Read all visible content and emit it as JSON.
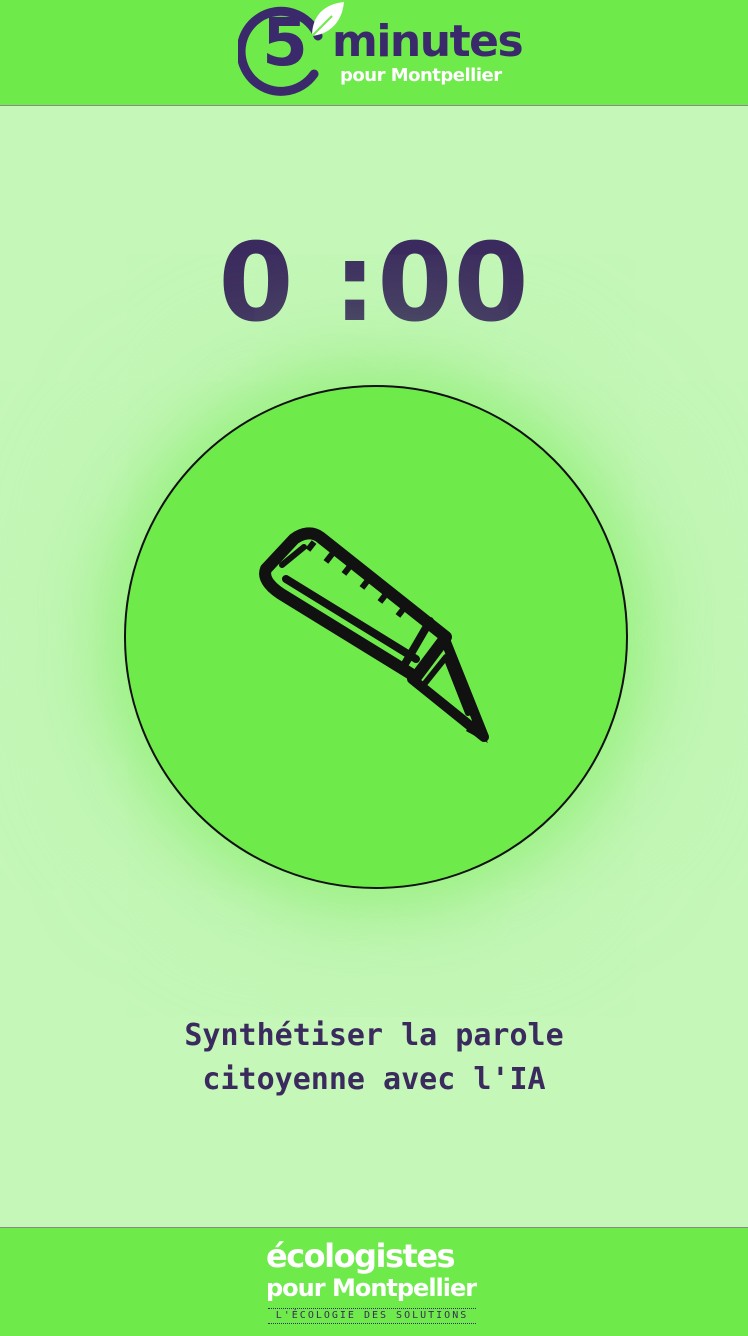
{
  "header": {
    "logo_number": "5",
    "logo_word": "minutes",
    "logo_subtitle": "pour Montpellier"
  },
  "timer": {
    "display": "0 :00"
  },
  "record_button": {
    "icon": "pencil-icon"
  },
  "caption": {
    "line1": "Synthétiser la parole",
    "line2": "citoyenne avec l'IA"
  },
  "footer": {
    "logo_word": "écologistes",
    "logo_subtitle": "pour Montpellier",
    "slogan": "L'ÉCOLOGIE DES SOLUTIONS"
  },
  "colors": {
    "background": "#c4f7b8",
    "accent_green": "#6fea4b",
    "brand_purple": "#3b2a6b"
  }
}
